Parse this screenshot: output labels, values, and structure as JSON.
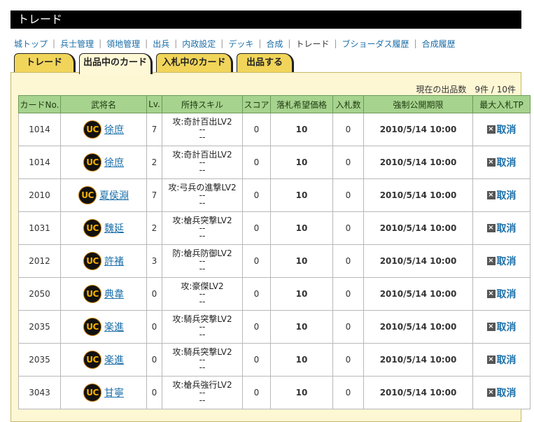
{
  "title": "トレード",
  "nav": {
    "items": [
      {
        "label": "城トップ",
        "link": true
      },
      {
        "label": "兵士管理",
        "link": true
      },
      {
        "label": "領地管理",
        "link": true
      },
      {
        "label": "出兵",
        "link": true
      },
      {
        "label": "内政設定",
        "link": true
      },
      {
        "label": "デッキ",
        "link": true
      },
      {
        "label": "合成",
        "link": true
      },
      {
        "label": "トレード",
        "link": false
      },
      {
        "label": "ブショーダス履歴",
        "link": true
      },
      {
        "label": "合成履歴",
        "link": true
      }
    ]
  },
  "tabs": [
    {
      "label": "トレード",
      "active": false
    },
    {
      "label": "出品中のカード",
      "active": true
    },
    {
      "label": "入札中のカード",
      "active": false
    },
    {
      "label": "出品する",
      "active": false
    }
  ],
  "listing_count": "現在の出品数　9件 / 10件",
  "columns": [
    "カードNo.",
    "武将名",
    "Lv.",
    "所持スキル",
    "スコア",
    "落札希望価格",
    "入札数",
    "強制公開期限",
    "最大入札TP"
  ],
  "rarity_badge": "UC",
  "cancel_label": "取消",
  "colors": {
    "header_bg": "#a6d38e",
    "tab_bg": "#f1d55a",
    "panel_bg": "#fdf7d4",
    "link": "#1a6ea8"
  },
  "rows": [
    {
      "no": "1014",
      "name": "徐庶",
      "lv": "7",
      "skill1": "攻:奇計百出LV2",
      "skill2": "--",
      "skill3": "--",
      "score": "0",
      "price": "10",
      "bids": "0",
      "deadline": "2010/5/14 10:00"
    },
    {
      "no": "1014",
      "name": "徐庶",
      "lv": "2",
      "skill1": "攻:奇計百出LV2",
      "skill2": "--",
      "skill3": "--",
      "score": "0",
      "price": "10",
      "bids": "0",
      "deadline": "2010/5/14 10:00"
    },
    {
      "no": "2010",
      "name": "夏侯淵",
      "lv": "7",
      "skill1": "攻:弓兵の進撃LV2",
      "skill2": "--",
      "skill3": "--",
      "score": "0",
      "price": "10",
      "bids": "0",
      "deadline": "2010/5/14 10:00"
    },
    {
      "no": "1031",
      "name": "魏延",
      "lv": "2",
      "skill1": "攻:槍兵突撃LV2",
      "skill2": "--",
      "skill3": "--",
      "score": "0",
      "price": "10",
      "bids": "0",
      "deadline": "2010/5/14 10:00"
    },
    {
      "no": "2012",
      "name": "許褚",
      "lv": "3",
      "skill1": "防:槍兵防御LV2",
      "skill2": "--",
      "skill3": "--",
      "score": "0",
      "price": "10",
      "bids": "0",
      "deadline": "2010/5/14 10:00"
    },
    {
      "no": "2050",
      "name": "典韋",
      "lv": "0",
      "skill1": "攻:豪傑LV2",
      "skill2": "--",
      "skill3": "--",
      "score": "0",
      "price": "10",
      "bids": "0",
      "deadline": "2010/5/14 10:00"
    },
    {
      "no": "2035",
      "name": "楽進",
      "lv": "0",
      "skill1": "攻:騎兵突撃LV2",
      "skill2": "--",
      "skill3": "--",
      "score": "0",
      "price": "10",
      "bids": "0",
      "deadline": "2010/5/14 10:00"
    },
    {
      "no": "2035",
      "name": "楽進",
      "lv": "0",
      "skill1": "攻:騎兵突撃LV2",
      "skill2": "--",
      "skill3": "--",
      "score": "0",
      "price": "10",
      "bids": "0",
      "deadline": "2010/5/14 10:00"
    },
    {
      "no": "3043",
      "name": "甘寧",
      "lv": "0",
      "skill1": "攻:槍兵強行LV2",
      "skill2": "--",
      "skill3": "--",
      "score": "0",
      "price": "10",
      "bids": "0",
      "deadline": "2010/5/14 10:00"
    }
  ]
}
